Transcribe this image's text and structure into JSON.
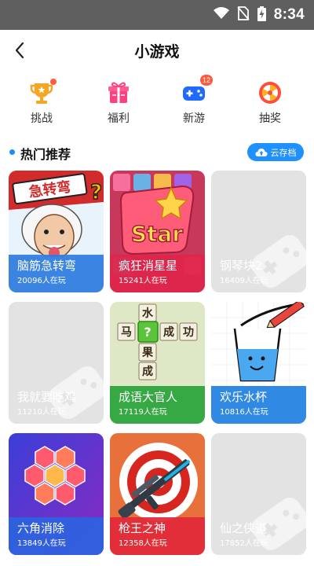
{
  "status_bar": {
    "time": "8:34"
  },
  "header": {
    "title": "小游戏"
  },
  "categories": [
    {
      "label": "挑战",
      "icon": "trophy-icon",
      "color": "#f5a623",
      "dot": true
    },
    {
      "label": "福利",
      "icon": "gift-icon",
      "color": "#ff3f7f"
    },
    {
      "label": "新游",
      "icon": "gamepad-icon",
      "color": "#1f6bff",
      "badge": "12"
    },
    {
      "label": "抽奖",
      "icon": "lottery-wheel-icon",
      "color": "#ff4d3a"
    }
  ],
  "section": {
    "title": "热门推荐",
    "cloud_button": "云存档"
  },
  "games": [
    {
      "name": "脑筋急转弯",
      "players": "20096人在玩",
      "banner_text": "急转弯"
    },
    {
      "name": "疯狂消星星",
      "players": "15241人在玩",
      "banner_text": "Star"
    },
    {
      "name": "钢琴块2",
      "players": "16409人在玩"
    },
    {
      "name": "我就要吃鸡",
      "players": "11210人在玩"
    },
    {
      "name": "成语大官人",
      "players": "17119人在玩",
      "tiles": [
        "水",
        "马",
        "?",
        "成",
        "功",
        "果",
        "成"
      ]
    },
    {
      "name": "欢乐水杯",
      "players": "10816人在玩"
    },
    {
      "name": "六角消除",
      "players": "13849人在玩"
    },
    {
      "name": "枪王之神",
      "players": "12358人在玩"
    },
    {
      "name": "仙之侠道",
      "players": "17852人在玩"
    }
  ],
  "colors": {
    "accent": "#1e90ff",
    "badge": "#ff5a3c",
    "status_bar": "#5f5f5f"
  }
}
